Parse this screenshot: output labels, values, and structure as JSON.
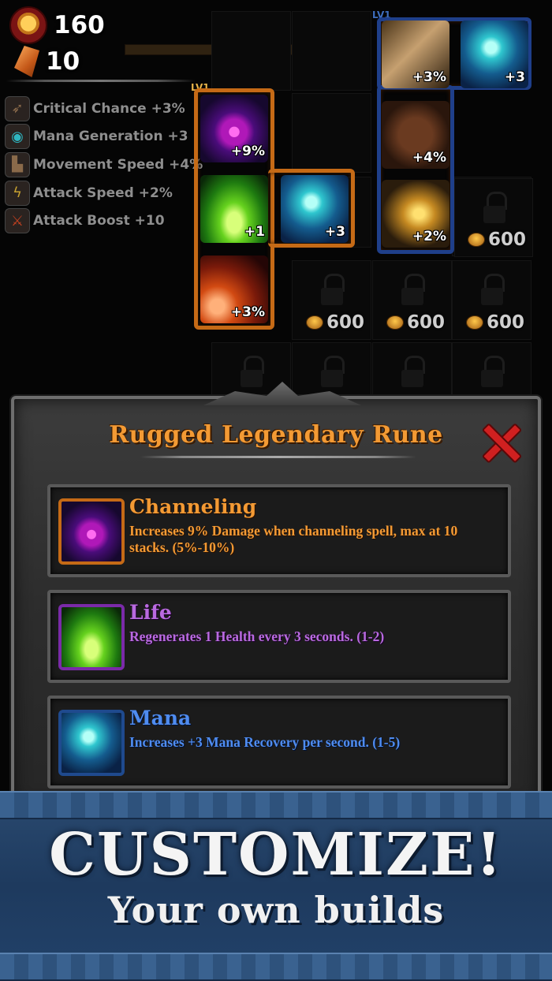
{
  "hud": {
    "gold": "160",
    "gems": "10"
  },
  "stats": [
    {
      "label": "Critical Chance +3%",
      "icon": "bow-icon"
    },
    {
      "label": "Mana Generation +3",
      "icon": "mana-claw-icon"
    },
    {
      "label": "Movement Speed +4%",
      "icon": "boot-icon"
    },
    {
      "label": "Attack Speed +2%",
      "icon": "lightning-icon"
    },
    {
      "label": "Attack Boost +10",
      "icon": "sword-icon"
    }
  ],
  "rune_board": {
    "level_label_main": "LV1",
    "level_label_side": "LV1",
    "placed_runes": [
      {
        "name": "channeling",
        "bonus": "+9%"
      },
      {
        "name": "life",
        "bonus": "+1"
      },
      {
        "name": "mana",
        "bonus": "+3"
      },
      {
        "name": "fire",
        "bonus": "+3%"
      }
    ],
    "equipped_column": [
      {
        "name": "critical",
        "bonus": "+3%"
      },
      {
        "name": "mana",
        "bonus": "+3"
      },
      {
        "name": "movement",
        "bonus": "+4%"
      },
      {
        "name": "attack-speed",
        "bonus": "+2%"
      }
    ],
    "locked_price": "600"
  },
  "dialog": {
    "title": "Rugged Legendary Rune",
    "runes": [
      {
        "name": "Channeling",
        "description": "Increases 9% Damage when channeling spell, max at 10 stacks. (5%-10%)",
        "color": "#f39a34"
      },
      {
        "name": "Life",
        "description": "Regenerates 1 Health every 3 seconds. (1-2)",
        "color": "#b96ae0"
      },
      {
        "name": "Mana",
        "description": "Increases +3 Mana Recovery per second. (1-5)",
        "color": "#4f8cf0"
      }
    ]
  },
  "banner": {
    "headline": "CUSTOMIZE!",
    "subline": "Your own builds"
  }
}
